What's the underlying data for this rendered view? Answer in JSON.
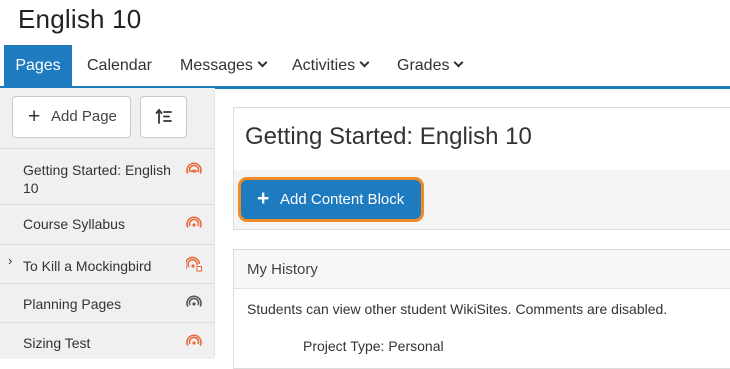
{
  "course": {
    "title": "English 10"
  },
  "nav": {
    "tabs": [
      {
        "label": "Pages",
        "active": true,
        "dropdown": false
      },
      {
        "label": "Calendar",
        "active": false,
        "dropdown": false
      },
      {
        "label": "Messages",
        "active": false,
        "dropdown": true
      },
      {
        "label": "Activities",
        "active": false,
        "dropdown": true
      },
      {
        "label": "Grades",
        "active": false,
        "dropdown": true
      }
    ]
  },
  "sidebar": {
    "add_page_label": "Add Page",
    "sort_icon": "sort-order-icon",
    "pages": [
      {
        "line1": "Getting Started: English",
        "line2": "10",
        "icon": "broadcast-icon",
        "icon_color": "#e86b3a",
        "expandable": false
      },
      {
        "line1": "Course Syllabus",
        "icon": "broadcast-icon",
        "icon_color": "#e86b3a",
        "expandable": false
      },
      {
        "line1": "To Kill a Mockingbird",
        "icon": "broadcast-scheduled-icon",
        "icon_color": "#e86b3a",
        "expandable": true
      },
      {
        "line1": "Planning Pages",
        "icon": "broadcast-icon",
        "icon_color": "#555555",
        "expandable": false
      },
      {
        "line1": "Sizing Test",
        "icon": "broadcast-icon",
        "icon_color": "#e86b3a",
        "expandable": false
      }
    ]
  },
  "main": {
    "page_title": "Getting Started: English 10",
    "add_content_block_label": "Add Content Block",
    "history": {
      "title": "My History",
      "description": "Students can view other student WikiSites. Comments are disabled.",
      "project_type": "Project Type: Personal"
    }
  },
  "colors": {
    "accent": "#1f7bbf",
    "highlight_outline": "#f08a24",
    "published_icon": "#e86b3a"
  }
}
